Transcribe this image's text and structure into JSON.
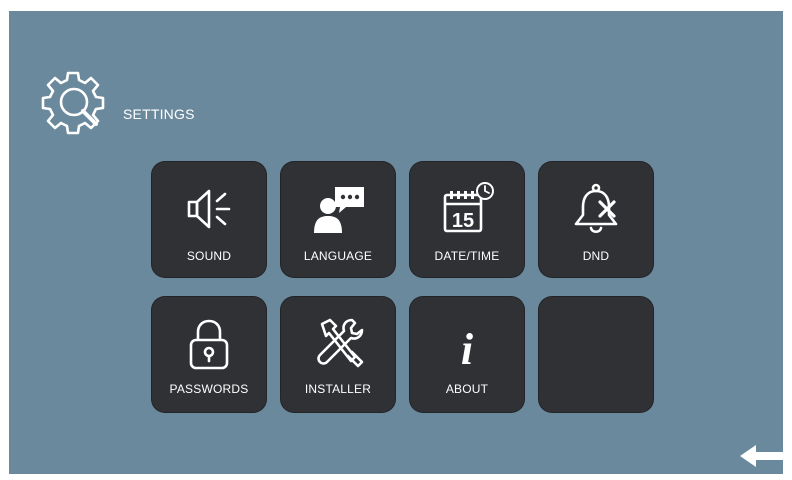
{
  "header": {
    "title": "SETTINGS",
    "icon": "settings-gear-icon"
  },
  "tiles": [
    {
      "label": "SOUND",
      "icon": "speaker-icon"
    },
    {
      "label": "LANGUAGE",
      "icon": "language-chat-icon"
    },
    {
      "label": "DATE/TIME",
      "icon": "calendar-clock-icon",
      "calendar_day": "15"
    },
    {
      "label": "DND",
      "icon": "bell-off-icon"
    },
    {
      "label": "PASSWORDS",
      "icon": "lock-icon"
    },
    {
      "label": "INSTALLER",
      "icon": "tools-icon"
    },
    {
      "label": "ABOUT",
      "icon": "info-icon",
      "glyph": "i"
    },
    {
      "label": "",
      "icon": ""
    }
  ],
  "back": {
    "icon": "back-arrow-icon"
  },
  "colors": {
    "background": "#6b899c",
    "tile": "#2f3135",
    "text": "#ffffff"
  }
}
